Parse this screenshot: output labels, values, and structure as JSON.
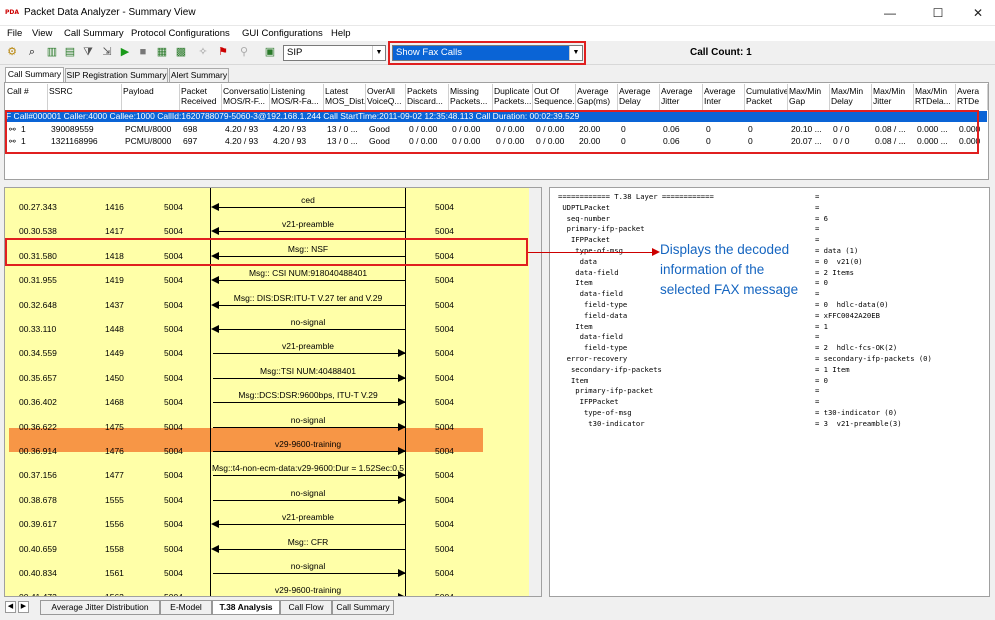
{
  "window": {
    "title": "Packet Data Analyzer - Summary View",
    "logo": "PDA",
    "minimize": "—",
    "maximize": "☐",
    "close": "✕"
  },
  "menu": [
    "File",
    "View",
    "Call Summary",
    "Protocol Configurations",
    "GUI Configurations",
    "Help"
  ],
  "toolbar": {
    "protocol_value": "SIP",
    "filter_value": "Show Fax Calls",
    "call_count": "Call Count: 1"
  },
  "summary_tabs": [
    "Call Summary",
    "SIP Registration Summary",
    "Alert Summary"
  ],
  "grid": {
    "headers": [
      "Call #",
      "SSRC",
      "Payload",
      "Packet Received",
      "Conversation MOS/R-F...",
      "Listening MOS/R-Fa...",
      "Latest MOS_Dist...",
      "OverAll VoiceQ...",
      "Packets Discard...",
      "Missing Packets...",
      "Duplicate Packets...",
      "Out Of Sequence...",
      "Average Gap(ms)",
      "Average Delay",
      "Average Jitter",
      "Average Inter",
      "Cumulative Packet",
      "Max/Min Gap",
      "Max/Min Delay",
      "Max/Min Jitter",
      "Max/Min RTDela...",
      "Avera RTDe"
    ],
    "call_row": "F  Call#000001  Caller:4000 Callee:1000 CallId:1620788079-5060-3@192.168.1.244 Call StartTime:2011-09-02 12:35:48.113 Call Duration: 00:02:39.529",
    "rows": [
      [
        "1",
        "390089559",
        "PCMU/8000",
        "698",
        "4.20 / 93",
        "4.20 / 93",
        "13 / 0 ...",
        "Good",
        "0 / 0.00",
        "0 / 0.00",
        "0 / 0.00",
        "0 / 0.00",
        "20.00",
        "0",
        "0.06",
        "0",
        "0",
        "20.10 ...",
        "0 / 0",
        "0.08 / ...",
        "0.000 ...",
        "0.000"
      ],
      [
        "1",
        "1321168996",
        "PCMU/8000",
        "697",
        "4.20 / 93",
        "4.20 / 93",
        "13 / 0 ...",
        "Good",
        "0 / 0.00",
        "0 / 0.00",
        "0 / 0.00",
        "0 / 0.00",
        "20.00",
        "0",
        "0.06",
        "0",
        "0",
        "20.07 ...",
        "0 / 0",
        "0.08 / ...",
        "0.000 ...",
        "0.000"
      ]
    ]
  },
  "flow": [
    {
      "time": "00.27.343",
      "seq": "1416",
      "port": "5004",
      "msg": "ced",
      "dir": "left",
      "dest": "5004"
    },
    {
      "time": "00.30.538",
      "seq": "1417",
      "port": "5004",
      "msg": "v21-preamble",
      "dir": "left",
      "dest": "5004"
    },
    {
      "time": "00.31.580",
      "seq": "1418",
      "port": "5004",
      "msg": "Msg:: NSF",
      "dir": "left",
      "dest": "5004"
    },
    {
      "time": "00.31.955",
      "seq": "1419",
      "port": "5004",
      "msg": "Msg:: CSI NUM:918040488401",
      "dir": "left",
      "dest": "5004"
    },
    {
      "time": "00.32.648",
      "seq": "1437",
      "port": "5004",
      "msg": "Msg:: DIS:DSR:ITU-T V.27 ter and V.29",
      "dir": "left",
      "dest": "5004"
    },
    {
      "time": "00.33.110",
      "seq": "1448",
      "port": "5004",
      "msg": "no-signal",
      "dir": "left",
      "dest": "5004"
    },
    {
      "time": "00.34.559",
      "seq": "1449",
      "port": "5004",
      "msg": "v21-preamble",
      "dir": "right",
      "dest": "5004"
    },
    {
      "time": "00.35.657",
      "seq": "1450",
      "port": "5004",
      "msg": "Msg::TSI NUM:40488401",
      "dir": "right",
      "dest": "5004"
    },
    {
      "time": "00.36.402",
      "seq": "1468",
      "port": "5004",
      "msg": "Msg::DCS:DSR:9600bps, ITU-T V.29",
      "dir": "right",
      "dest": "5004"
    },
    {
      "time": "00.36.622",
      "seq": "1475",
      "port": "5004",
      "msg": "no-signal",
      "dir": "right",
      "dest": "5004"
    },
    {
      "time": "00.36.914",
      "seq": "1476",
      "port": "5004",
      "msg": "v29-9600-training",
      "dir": "right",
      "dest": "5004"
    },
    {
      "time": "00.37.156",
      "seq": "1477",
      "port": "5004",
      "msg": "Msg::t4-non-ecm-data:v29-9600:Dur = 1.52Sec:0.5",
      "dir": "right",
      "dest": "5004"
    },
    {
      "time": "00.38.678",
      "seq": "1555",
      "port": "5004",
      "msg": "no-signal",
      "dir": "right",
      "dest": "5004"
    },
    {
      "time": "00.39.617",
      "seq": "1556",
      "port": "5004",
      "msg": "v21-preamble",
      "dir": "left",
      "dest": "5004"
    },
    {
      "time": "00.40.659",
      "seq": "1558",
      "port": "5004",
      "msg": "Msg:: CFR",
      "dir": "left",
      "dest": "5004"
    },
    {
      "time": "00.40.834",
      "seq": "1561",
      "port": "5004",
      "msg": "no-signal",
      "dir": "right",
      "dest": "5004"
    },
    {
      "time": "00.41.473",
      "seq": "1562",
      "port": "5004",
      "msg": "v29-9600-training",
      "dir": "right",
      "dest": "5004"
    }
  ],
  "t38": [
    [
      "============ T.38 Layer ============",
      "="
    ],
    [
      " UDPTLPacket",
      "="
    ],
    [
      "  seq-number",
      "= 6"
    ],
    [
      "  primary-ifp-packet",
      "="
    ],
    [
      "   IFPPacket",
      "="
    ],
    [
      "    type-of-msg",
      "= data (1)"
    ],
    [
      "     data",
      "= 0  v21(0)"
    ],
    [
      "    data-field",
      "= 2 Items"
    ],
    [
      "    Item",
      "= 0"
    ],
    [
      "     data-field",
      "="
    ],
    [
      "      field-type",
      "= 0  hdlc-data(0)"
    ],
    [
      "      field-data",
      "= xFFC0042A20EB"
    ],
    [
      "    Item",
      "= 1"
    ],
    [
      "     data-field",
      "="
    ],
    [
      "      field-type",
      "= 2  hdlc-fcs-OK(2)"
    ],
    [
      "  error-recovery",
      "= secondary-ifp-packets (0)"
    ],
    [
      "   secondary-ifp-packets",
      "= 1 Item"
    ],
    [
      "   Item",
      "= 0"
    ],
    [
      "    primary-ifp-packet",
      "="
    ],
    [
      "     IFPPacket",
      "="
    ],
    [
      "      type-of-msg",
      "= t30-indicator (0)"
    ],
    [
      "       t30-indicator",
      "= 3  v21-preamble(3)"
    ]
  ],
  "callout": "Displays the decoded information of the selected FAX message",
  "bottom_tabs": [
    "Average Jitter Distribution",
    "E-Model",
    "T.38 Analysis",
    "Call Flow",
    "Call Summary"
  ],
  "colors": {
    "selection": "#0a64d6",
    "flow_bg": "#ffffa8",
    "selected_msg": "#f79646",
    "highlight_border": "#e01f1f",
    "callout_text": "#1565c0"
  }
}
